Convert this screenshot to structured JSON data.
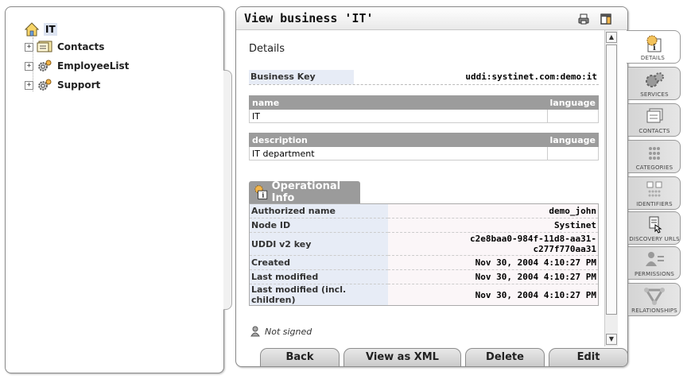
{
  "tree": {
    "root": {
      "label": "IT"
    },
    "items": [
      {
        "label": "Contacts",
        "icon": "contact-card-icon"
      },
      {
        "label": "EmployeeList",
        "icon": "gear-service-icon"
      },
      {
        "label": "Support",
        "icon": "gear-service-icon"
      }
    ]
  },
  "main": {
    "title": "View business 'IT'",
    "section_heading": "Details",
    "business_key": {
      "label": "Business Key",
      "value": "uddi:systinet.com:demo:it"
    },
    "names": {
      "col_name": "name",
      "col_language": "language",
      "rows": [
        {
          "name": "IT",
          "language": ""
        }
      ]
    },
    "descriptions": {
      "col_description": "description",
      "col_language": "language",
      "rows": [
        {
          "description": "IT department",
          "language": ""
        }
      ]
    },
    "operational": {
      "header": "Operational Info",
      "rows": [
        {
          "label": "Authorized name",
          "value": "demo_john"
        },
        {
          "label": "Node ID",
          "value": "Systinet"
        },
        {
          "label": "UDDI v2 key",
          "value": "c2e8baa0-984f-11d8-aa31-\nc277f770aa31"
        },
        {
          "label": "Created",
          "value": "Nov 30, 2004 4:10:27 PM"
        },
        {
          "label": "Last modified",
          "value": "Nov 30, 2004 4:10:27 PM"
        },
        {
          "label": "Last modified (incl. children)",
          "value": "Nov 30, 2004 4:10:27 PM"
        }
      ]
    },
    "signature": "Not signed"
  },
  "buttons": {
    "back": "Back",
    "view_xml": "View as XML",
    "delete": "Delete",
    "edit": "Edit"
  },
  "side_tabs": [
    {
      "label": "DETAILS",
      "icon": "details-icon",
      "active": true
    },
    {
      "label": "SERVICES",
      "icon": "gear-service-icon"
    },
    {
      "label": "CONTACTS",
      "icon": "contact-card-icon"
    },
    {
      "label": "CATEGORIES",
      "icon": "categories-icon"
    },
    {
      "label": "IDENTIFIERS",
      "icon": "identifiers-icon"
    },
    {
      "label": "DISCOVERY URLS",
      "icon": "discovery-url-icon"
    },
    {
      "label": "PERMISSIONS",
      "icon": "permissions-icon"
    },
    {
      "label": "RELATIONSHIPS",
      "icon": "relationships-icon"
    }
  ]
}
